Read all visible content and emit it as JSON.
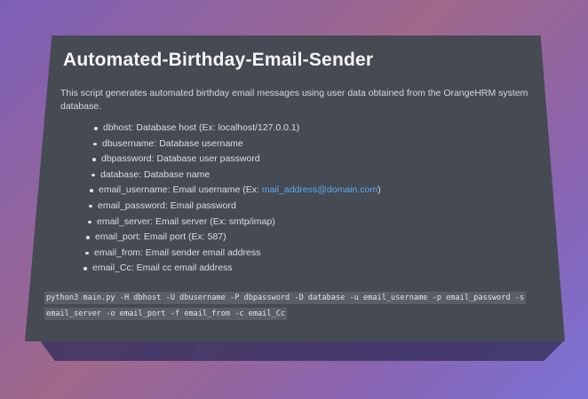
{
  "readme": {
    "title": "Automated-Birthday-Email-Sender",
    "description": "This script generates automated birthday email messages using user data obtained from the OrangeHRM system database.",
    "params": [
      {
        "text": "dbhost: Database host (Ex: localhost/127.0.0.1)"
      },
      {
        "text": "dbusername: Database username"
      },
      {
        "text": "dbpassword: Database user password"
      },
      {
        "text": "database: Database name"
      },
      {
        "text_before": "email_username: Email username (Ex: ",
        "link": "mail_address@domain.com",
        "text_after": ")"
      },
      {
        "text": "email_password: Email password"
      },
      {
        "text": "email_server: Email server (Ex: smtp/imap)"
      },
      {
        "text": "email_port: Email port (Ex: 587)"
      },
      {
        "text": "email_from: Email sender email address"
      },
      {
        "text": "email_Cc: Email cc email address"
      }
    ],
    "command": "python3 main.py -H dbhost -U dbusername -P dbpassword -D database -u email_username -p email_password -s email_server -o email_port -f email_from -c email_Cc",
    "colors": {
      "card_background": "#464a53",
      "link": "#5aaaf0",
      "code_background": "#5a5e67"
    }
  }
}
